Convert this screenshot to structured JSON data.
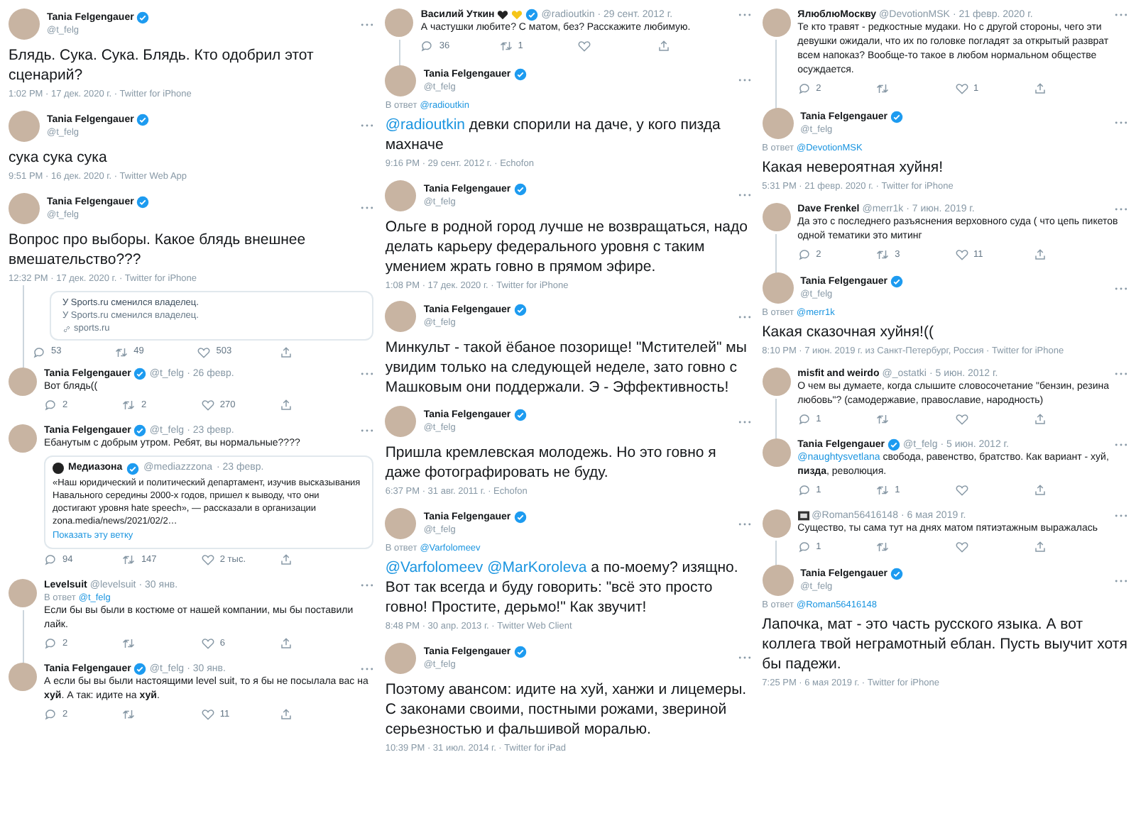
{
  "columns": [
    {
      "tweets": [
        {
          "kind": "main",
          "name": "Tania Felgengauer",
          "verified": true,
          "handle": "@t_felg",
          "segments": [
            {
              "kind": "plain",
              "text": "Блядь. Сука. Сука. Блядь. Кто одобрил этот сценарий?"
            }
          ],
          "meta": "1:02 PM · 17 дек. 2020 г. · Twitter for iPhone",
          "thread": false
        },
        {
          "kind": "main",
          "name": "Tania Felgengauer",
          "verified": true,
          "handle": "@t_felg",
          "segments": [
            {
              "kind": "plain",
              "text": "сука сука сука"
            }
          ],
          "meta": "9:51 PM · 16 дек. 2020 г. · Twitter Web App",
          "thread": false
        },
        {
          "kind": "main",
          "name": "Tania Felgengauer",
          "verified": true,
          "handle": "@t_felg",
          "segments": [
            {
              "kind": "plain",
              "text": "Вопрос про выборы. Какое блядь внешнее вмешательство???"
            }
          ],
          "meta": "12:32 PM · 17 дек. 2020 г. · Twitter for iPhone",
          "card": {
            "title": "У Sports.ru сменился владелец.",
            "description": "У Sports.ru сменился владелец.",
            "domain": "sports.ru"
          },
          "actions": {
            "reply": "53",
            "retweet": "49",
            "like": "503"
          },
          "thread": true
        },
        {
          "kind": "reply",
          "name": "Tania Felgengauer",
          "verified": true,
          "handle": "@t_felg",
          "date": "· 26 февр.",
          "segments": [
            {
              "kind": "plain",
              "text": "Вот блядь(("
            }
          ],
          "actions": {
            "reply": "2",
            "retweet": "2",
            "like": "270"
          },
          "thread": false
        },
        {
          "kind": "reply",
          "name": "Tania Felgengauer",
          "verified": true,
          "handle": "@t_felg",
          "date": "· 23 февр.",
          "segments": [
            {
              "kind": "plain",
              "text": "Ебанутым с добрым утром. Ребят, вы нормальные????"
            }
          ],
          "quote": {
            "name": "Медиазона",
            "verified": true,
            "handle": "@mediazzzona",
            "date": "· 23 февр.",
            "text": "«Наш юридический и политический департамент, изучив высказывания Навального середины 2000-х годов, пришел к выводу, что они достигают уровня hate speech», — рассказали в организации zona.media/news/2021/02/2…",
            "link": "Показать эту ветку"
          },
          "actions": {
            "reply": "94",
            "retweet": "147",
            "like": "2 тыс."
          },
          "thread": false
        },
        {
          "kind": "reply",
          "name": "Levelsuit",
          "verified": false,
          "handle": "@levelsuit",
          "date": "· 30 янв.",
          "reply_to": {
            "label": "В ответ",
            "handle": "@t_felg"
          },
          "segments": [
            {
              "kind": "plain",
              "text": "Если бы вы были в костюме от нашей компании, мы бы поставили лайк."
            }
          ],
          "actions": {
            "reply": "2",
            "like": "6"
          },
          "thread": true
        },
        {
          "kind": "reply",
          "name": "Tania Felgengauer",
          "verified": true,
          "handle": "@t_felg",
          "date": "· 30 янв.",
          "segments": [
            {
              "kind": "plain",
              "text": "А если бы вы были настоящими level suit, то я бы не посылала вас на **хуй**. А так: идите на **хуй**."
            }
          ],
          "actions": {
            "reply": "2",
            "like": "11"
          },
          "thread": false
        }
      ]
    },
    {
      "tweets": [
        {
          "kind": "reply",
          "name": "Василий Уткин",
          "hearts": [
            {
              "color": "#222222"
            },
            {
              "color": "#f5c518"
            }
          ],
          "verified": true,
          "handle": "@radioutkin",
          "date": "· 29 сент. 2012 г.",
          "segments": [
            {
              "kind": "plain",
              "text": "А частушки любите? С матом, без? Расскажите любимую."
            }
          ],
          "actions": {
            "reply": "36",
            "retweet": "1"
          },
          "thread": true
        },
        {
          "kind": "main",
          "name": "Tania Felgengauer",
          "verified": true,
          "handle": "@t_felg",
          "reply_to": {
            "label": "В ответ",
            "handle": "@radioutkin"
          },
          "segments": [
            {
              "kind": "mention",
              "text": "@radioutkin"
            },
            {
              "kind": "plain",
              "text": " девки спорили на даче, у кого пизда махначе"
            }
          ],
          "meta": "9:16 PM · 29 сент. 2012 г. · Echofon",
          "thread": false
        },
        {
          "kind": "main",
          "name": "Tania Felgengauer",
          "verified": true,
          "handle": "@t_felg",
          "segments": [
            {
              "kind": "plain",
              "text": "Ольге в родной город лучше не возвращаться, надо делать карьеру федерального уровня с таким умением жрать говно в прямом эфире."
            }
          ],
          "meta": "1:08 PM · 17 дек. 2020 г. · Twitter for iPhone",
          "thread": false
        },
        {
          "kind": "main",
          "name": "Tania Felgengauer",
          "verified": true,
          "handle": "@t_felg",
          "segments": [
            {
              "kind": "plain",
              "text": "Минкульт - такой ёбаное позорище! \"Мстителей\" мы увидим только на следующей неделе, зато говно с Машковым они поддержали. Э - Эффективность!"
            }
          ],
          "thread": false
        },
        {
          "kind": "main",
          "name": "Tania Felgengauer",
          "verified": true,
          "handle": "@t_felg",
          "segments": [
            {
              "kind": "plain",
              "text": "Пришла кремлевская молодежь. Но это говно я даже фотографировать не буду."
            }
          ],
          "meta": "6:37 PM · 31 авг. 2011 г. · Echofon",
          "thread": false
        },
        {
          "kind": "main",
          "name": "Tania Felgengauer",
          "verified": true,
          "handle": "@t_felg",
          "reply_to": {
            "label": "В ответ",
            "handle": "@Varfolomeev"
          },
          "segments": [
            {
              "kind": "mention",
              "text": "@Varfolomeev"
            },
            {
              "kind": "mention",
              "text": " @MarKoroleva"
            },
            {
              "kind": "plain",
              "text": " а по-моему? изящно. Вот так всегда и буду говорить: \"всё это просто говно! Простите, дерьмо!\" Как звучит!"
            }
          ],
          "meta": "8:48 PM · 30 апр. 2013 г. · Twitter Web Client",
          "thread": false
        },
        {
          "kind": "main",
          "name": "Tania Felgengauer",
          "verified": true,
          "handle": "@t_felg",
          "segments": [
            {
              "kind": "plain",
              "text": "Поэтому авансом: идите на хуй, ханжи и лицемеры. С законами своими, постными рожами, звериной серьезностью и фальшивой моралью."
            }
          ],
          "meta": "10:39 PM · 31 июл. 2014 г. · Twitter for iPad",
          "thread": false
        }
      ]
    },
    {
      "tweets": [
        {
          "kind": "reply",
          "name": "ЯлюблюМоскву",
          "verified": false,
          "handle": "@DevotionMSK",
          "date": "· 21 февр. 2020 г.",
          "segments": [
            {
              "kind": "plain",
              "text": "Те кто травят - редкостные мудаки. Но с другой стороны, чего эти девушки ожидали, что их по головке погладят за открытый разврат всем напоказ? Вообще-то такое в любом нормальном обществе осуждается."
            }
          ],
          "actions": {
            "reply": "2",
            "like": "1"
          },
          "thread": true
        },
        {
          "kind": "main",
          "name": "Tania Felgengauer",
          "verified": true,
          "handle": "@t_felg",
          "reply_to": {
            "label": "В ответ",
            "handle": "@DevotionMSK"
          },
          "segments": [
            {
              "kind": "plain",
              "text": "Какая невероятная хуйня!"
            }
          ],
          "meta": "5:31 PM · 21 февр. 2020 г. · Twitter for iPhone",
          "thread": false
        },
        {
          "kind": "reply",
          "name": "Dave Frenkel",
          "verified": false,
          "handle": "@merr1k",
          "date": "· 7 июн. 2019 г.",
          "segments": [
            {
              "kind": "plain",
              "text": "Да это с последнего разъяснения верховного суда ( что цепь пикетов одной тематики это митинг"
            }
          ],
          "actions": {
            "reply": "2",
            "retweet": "3",
            "like": "11"
          },
          "thread": true
        },
        {
          "kind": "main",
          "name": "Tania Felgengauer",
          "verified": true,
          "handle": "@t_felg",
          "reply_to": {
            "label": "В ответ",
            "handle": "@merr1k"
          },
          "segments": [
            {
              "kind": "plain",
              "text": "Какая сказочная хуйня!(("
            }
          ],
          "meta": "8:10 PM · 7 июн. 2019 г. из Санкт-Петербург, Россия · Twitter for iPhone",
          "thread": false
        },
        {
          "kind": "reply",
          "name": "misfit and weirdo",
          "verified": false,
          "handle": "@_ostatki",
          "date": "· 5 июн. 2012 г.",
          "segments": [
            {
              "kind": "plain",
              "text": "О чем вы думаете, когда слышите словосочетание \"бензин, резина любовь\"? (самодержавие, православие, народность)"
            }
          ],
          "actions": {
            "reply": "1"
          },
          "thread": true
        },
        {
          "kind": "reply",
          "name": "Tania Felgengauer",
          "verified": true,
          "handle": "@t_felg",
          "date": "· 5 июн. 2012 г.",
          "segments": [
            {
              "kind": "mention",
              "text": "@naughtysvetlana"
            },
            {
              "kind": "plain",
              "text": " свобода, равенство, братство. Как вариант - хуй, **пизда**, революция."
            }
          ],
          "actions": {
            "reply": "1",
            "retweet": "1"
          },
          "thread": false
        },
        {
          "kind": "reply",
          "name_icon": true,
          "verified": false,
          "handle": "@Roman56416148",
          "date": "· 6 мая 2019 г.",
          "segments": [
            {
              "kind": "plain",
              "text": "Существо, ты сама тут на днях матом пятиэтажным выражалась"
            }
          ],
          "actions": {
            "reply": "1"
          },
          "thread": true
        },
        {
          "kind": "main",
          "name": "Tania Felgengauer",
          "verified": true,
          "handle": "@t_felg",
          "reply_to": {
            "label": "В ответ",
            "handle": "@Roman56416148"
          },
          "segments": [
            {
              "kind": "plain",
              "text": "Лапочка, мат - это часть русского языка. А вот коллега твой неграмотный еблан. Пусть выучит хотя бы падежи."
            }
          ],
          "meta": "7:25 PM · 6 мая 2019 г. · Twitter for iPhone",
          "thread": false
        }
      ]
    }
  ]
}
